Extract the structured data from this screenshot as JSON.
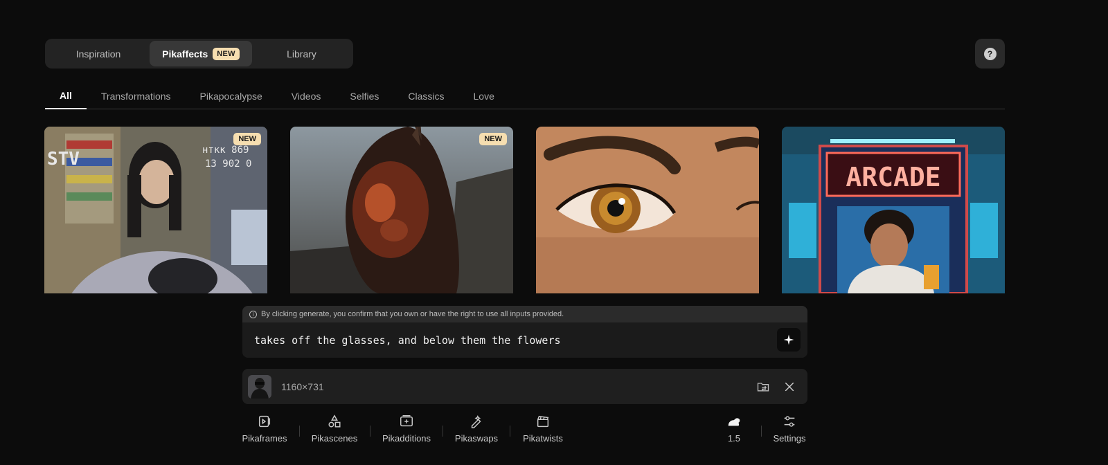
{
  "top_tabs": {
    "inspiration": "Inspiration",
    "pikaffects": "Pikaffects",
    "pikaffects_badge": "NEW",
    "library": "Library"
  },
  "help": {
    "icon": "question-icon",
    "glyph": "?"
  },
  "categories": [
    "All",
    "Transformations",
    "Pikapocalypse",
    "Videos",
    "Selfies",
    "Classics",
    "Love"
  ],
  "cards": [
    {
      "badge": "NEW",
      "overlay_left": "STV",
      "overlay_right_1": "нткк 869",
      "overlay_right_2": "13 902 0"
    },
    {
      "badge": "NEW"
    },
    {
      "badge": ""
    },
    {
      "sign": "ARCADE"
    }
  ],
  "disclaimer": {
    "icon": "info-icon",
    "glyph": "i",
    "text": "By clicking generate, you confirm that you own or have the right to use all inputs provided."
  },
  "prompt": {
    "value": "takes off the glasses, and below them the flowers",
    "generate_icon": "sparkle-icon"
  },
  "attachment": {
    "dimensions": "1160×731",
    "replace_icon": "folder-swap-icon",
    "remove_icon": "close-icon"
  },
  "toolbar": {
    "items": [
      {
        "label": "Pikaframes",
        "icon": "frames-icon"
      },
      {
        "label": "Pikascenes",
        "icon": "shapes-icon"
      },
      {
        "label": "Pikadditions",
        "icon": "add-video-icon"
      },
      {
        "label": "Pikaswaps",
        "icon": "wand-pen-icon"
      },
      {
        "label": "Pikatwists",
        "icon": "clapper-icon"
      }
    ],
    "model_version": "1.5",
    "model_icon": "rabbit-icon",
    "settings": "Settings",
    "settings_icon": "sliders-icon"
  },
  "colors": {
    "background": "#0c0c0c",
    "badge": "#f6deb0",
    "panel": "#232323"
  }
}
